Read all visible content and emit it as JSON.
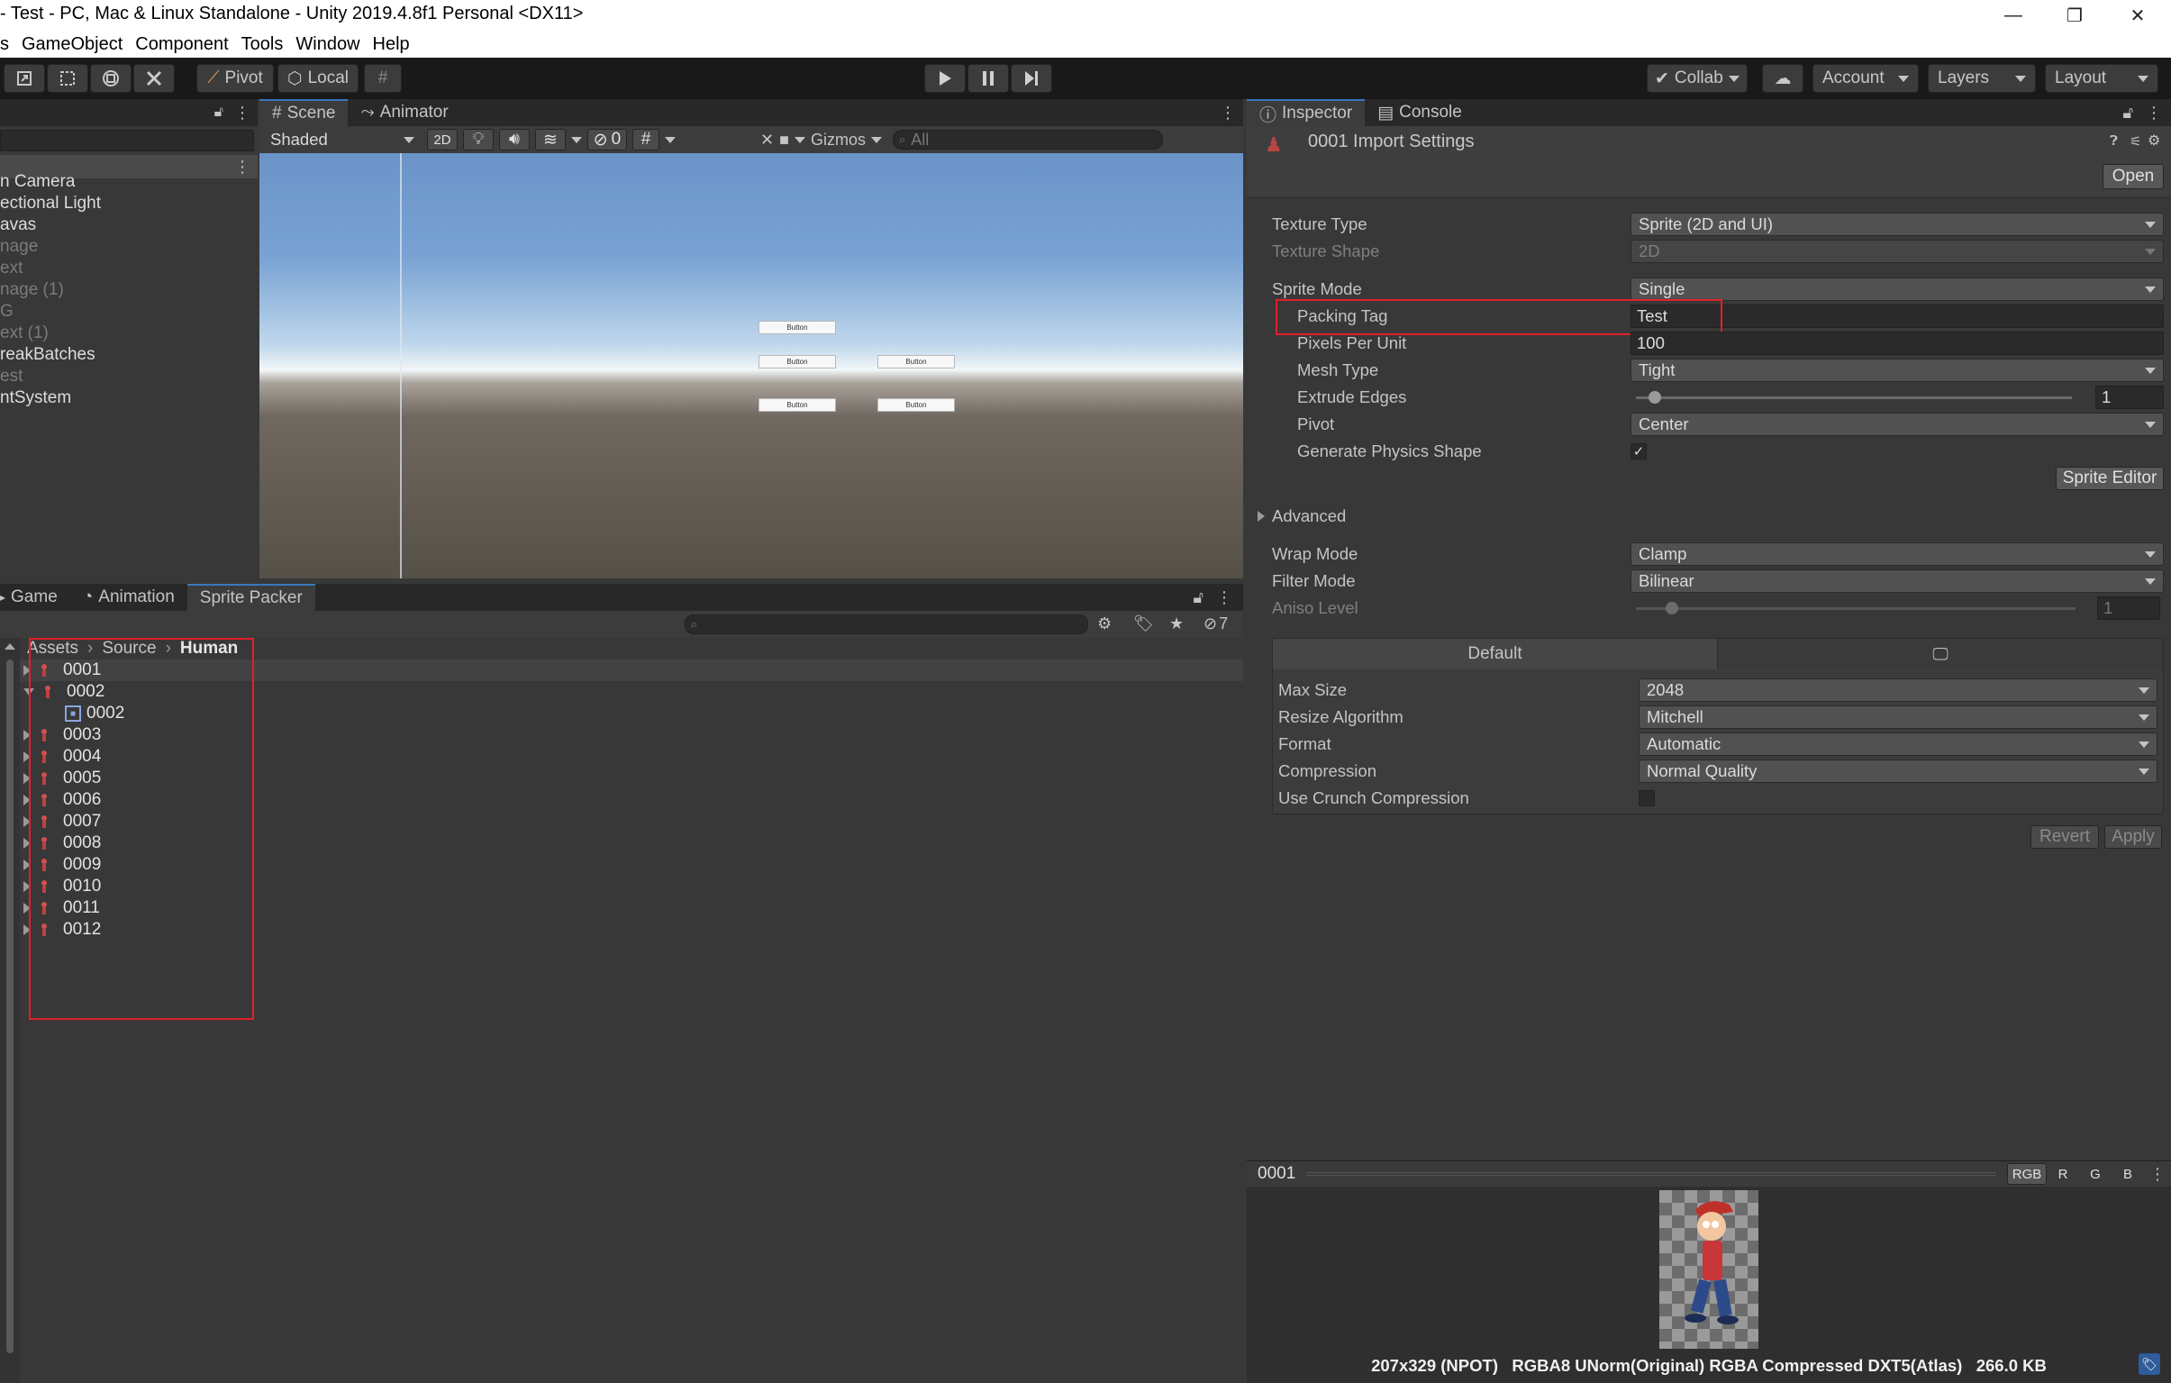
{
  "window": {
    "title": "- Test - PC, Mac & Linux Standalone - Unity 2019.4.8f1 Personal <DX11>",
    "minimize": "—",
    "restore": "❐",
    "close": "✕"
  },
  "menubar": [
    "s",
    "GameObject",
    "Component",
    "Tools",
    "Window",
    "Help"
  ],
  "toolbar": {
    "pivot": "Pivot",
    "local": "Local",
    "collab": "Collab",
    "account": "Account",
    "layers": "Layers",
    "layout": "Layout"
  },
  "hierarchy": {
    "items": [
      {
        "label": "n Camera",
        "dim": false
      },
      {
        "label": "ectional Light",
        "dim": false
      },
      {
        "label": "avas",
        "dim": false
      },
      {
        "label": "nage",
        "dim": true
      },
      {
        "label": "ext",
        "dim": true
      },
      {
        "label": "nage (1)",
        "dim": true
      },
      {
        "label": "G",
        "dim": true
      },
      {
        "label": "ext (1)",
        "dim": true
      },
      {
        "label": "reakBatches",
        "dim": false
      },
      {
        "label": "est",
        "dim": true
      },
      {
        "label": "ntSystem",
        "dim": false
      }
    ]
  },
  "scene": {
    "tabs": [
      "Scene",
      "Animator"
    ],
    "shading": "Shaded",
    "mode2d": "2D",
    "hidden_count": "0",
    "gizmos": "Gizmos",
    "search_placeholder": "All",
    "button_label": "Button"
  },
  "project": {
    "tabs": [
      "Game",
      "Animation",
      "Sprite Packer"
    ],
    "hidden_count": "7",
    "breadcrumb": [
      "Assets",
      "Source",
      "Human"
    ],
    "assets": [
      {
        "label": "0001",
        "open": false,
        "child": false
      },
      {
        "label": "0002",
        "open": true,
        "child": false
      },
      {
        "label": "0002",
        "open": false,
        "child": true
      },
      {
        "label": "0003",
        "open": false,
        "child": false
      },
      {
        "label": "0004",
        "open": false,
        "child": false
      },
      {
        "label": "0005",
        "open": false,
        "child": false
      },
      {
        "label": "0006",
        "open": false,
        "child": false
      },
      {
        "label": "0007",
        "open": false,
        "child": false
      },
      {
        "label": "0008",
        "open": false,
        "child": false
      },
      {
        "label": "0009",
        "open": false,
        "child": false
      },
      {
        "label": "0010",
        "open": false,
        "child": false
      },
      {
        "label": "0011",
        "open": false,
        "child": false
      },
      {
        "label": "0012",
        "open": false,
        "child": false
      }
    ]
  },
  "inspector": {
    "tabs": [
      "Inspector",
      "Console"
    ],
    "header_title": "0001 Import Settings",
    "open_button": "Open",
    "texture_type_label": "Texture Type",
    "texture_type_value": "Sprite (2D and UI)",
    "texture_shape_label": "Texture Shape",
    "texture_shape_value": "2D",
    "sprite_mode_label": "Sprite Mode",
    "sprite_mode_value": "Single",
    "packing_tag_label": "Packing Tag",
    "packing_tag_value": "Test",
    "ppu_label": "Pixels Per Unit",
    "ppu_value": "100",
    "mesh_type_label": "Mesh Type",
    "mesh_type_value": "Tight",
    "extrude_label": "Extrude Edges",
    "extrude_value": "1",
    "extrude_fraction": 0.03,
    "pivot_label": "Pivot",
    "pivot_value": "Center",
    "physics_label": "Generate Physics Shape",
    "physics_checked": "✓",
    "sprite_editor_button": "Sprite Editor",
    "advanced_label": "Advanced",
    "wrap_label": "Wrap Mode",
    "wrap_value": "Clamp",
    "filter_label": "Filter Mode",
    "filter_value": "Bilinear",
    "aniso_label": "Aniso Level",
    "aniso_value": "1",
    "aniso_fraction": 0.07,
    "platform_default": "Default",
    "max_size_label": "Max Size",
    "max_size_value": "2048",
    "resize_label": "Resize Algorithm",
    "resize_value": "Mitchell",
    "format_label": "Format",
    "format_value": "Automatic",
    "compression_label": "Compression",
    "compression_value": "Normal Quality",
    "crunch_label": "Use Crunch Compression",
    "revert_button": "Revert",
    "apply_button": "Apply"
  },
  "preview": {
    "name": "0001",
    "channels": [
      "RGB",
      "R",
      "G",
      "B"
    ],
    "info": "207x329 (NPOT)   RGBA8 UNorm(Original) RGBA Compressed DXT5(Atlas)   266.0 KB"
  }
}
